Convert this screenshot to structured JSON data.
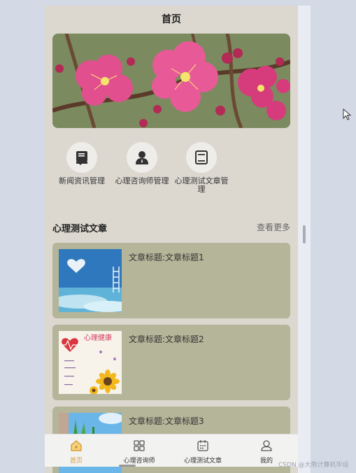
{
  "header": {
    "title": "首页"
  },
  "quick_links": [
    {
      "label": "新闻资讯管理",
      "icon": "book-bookmark-icon"
    },
    {
      "label": "心理咨询师管理",
      "icon": "person-icon"
    },
    {
      "label": "心理测试文章管理",
      "icon": "notebook-icon"
    }
  ],
  "section": {
    "title": "心理测试文章",
    "more": "查看更多"
  },
  "articles": [
    {
      "title": "文章标题:文章标题1"
    },
    {
      "title": "文章标题:文章标题2",
      "thumb_text": "心理健康"
    },
    {
      "title": "文章标题:文章标题3"
    }
  ],
  "tabbar": [
    {
      "label": "首页",
      "icon": "home-icon",
      "active": true
    },
    {
      "label": "心理咨询师",
      "icon": "grid-icon"
    },
    {
      "label": "心理测试文章",
      "icon": "calendar-icon"
    },
    {
      "label": "我的",
      "icon": "user-icon"
    }
  ],
  "watermark": "CSDN @大熊计算机毕设",
  "colors": {
    "accent": "#d89a3a",
    "card": "#b5b59a",
    "page": "#dcd8d0"
  }
}
